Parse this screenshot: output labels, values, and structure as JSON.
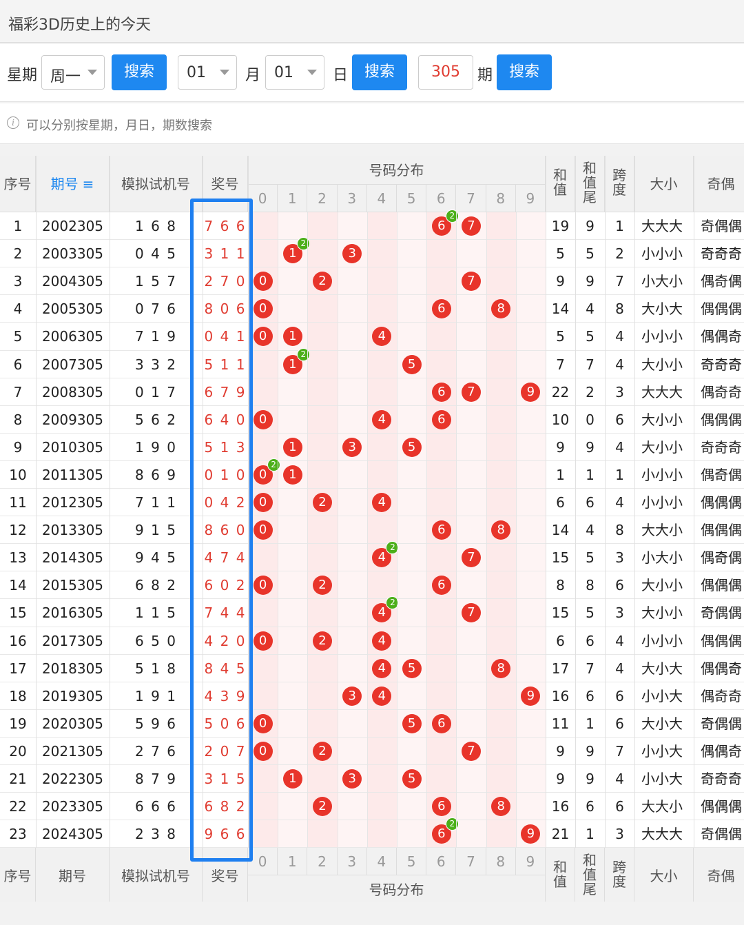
{
  "title": "福彩3D历史上的今天",
  "search": {
    "weekday_label": "星期",
    "weekday_value": "周一",
    "search_label": "搜索",
    "month_value": "01",
    "month_label": "月",
    "day_value": "01",
    "day_label": "日",
    "issue_value": "305",
    "issue_label": "期"
  },
  "hint": "可以分别按星期，月日，期数搜索",
  "table": {
    "headers": {
      "seq": "序号",
      "issue": "期号",
      "sim": "模拟试机号",
      "prize": "奖号",
      "dist": "号码分布",
      "sum": "和值",
      "sum_tail": "和值尾",
      "span": "跨度",
      "size": "大小",
      "parity": "奇偶"
    },
    "digits": [
      "0",
      "1",
      "2",
      "3",
      "4",
      "5",
      "6",
      "7",
      "8",
      "9"
    ],
    "rows": [
      {
        "seq": "1",
        "issue": "2002305",
        "sim": "1 6 8",
        "prize": "7 6 6",
        "sum": "19",
        "tail": "9",
        "span": "1",
        "size": "大大大",
        "parity": "奇偶偶"
      },
      {
        "seq": "2",
        "issue": "2003305",
        "sim": "0 4 5",
        "prize": "3 1 1",
        "sum": "5",
        "tail": "5",
        "span": "2",
        "size": "小小小",
        "parity": "奇奇奇"
      },
      {
        "seq": "3",
        "issue": "2004305",
        "sim": "1 5 7",
        "prize": "2 7 0",
        "sum": "9",
        "tail": "9",
        "span": "7",
        "size": "小大小",
        "parity": "偶奇偶"
      },
      {
        "seq": "4",
        "issue": "2005305",
        "sim": "0 7 6",
        "prize": "8 0 6",
        "sum": "14",
        "tail": "4",
        "span": "8",
        "size": "大小大",
        "parity": "偶偶偶"
      },
      {
        "seq": "5",
        "issue": "2006305",
        "sim": "7 1 9",
        "prize": "0 4 1",
        "sum": "5",
        "tail": "5",
        "span": "4",
        "size": "小小小",
        "parity": "偶偶奇"
      },
      {
        "seq": "6",
        "issue": "2007305",
        "sim": "3 3 2",
        "prize": "5 1 1",
        "sum": "7",
        "tail": "7",
        "span": "4",
        "size": "大小小",
        "parity": "奇奇奇"
      },
      {
        "seq": "7",
        "issue": "2008305",
        "sim": "0 1 7",
        "prize": "6 7 9",
        "sum": "22",
        "tail": "2",
        "span": "3",
        "size": "大大大",
        "parity": "偶奇奇"
      },
      {
        "seq": "8",
        "issue": "2009305",
        "sim": "5 6 2",
        "prize": "6 4 0",
        "sum": "10",
        "tail": "0",
        "span": "6",
        "size": "大小小",
        "parity": "偶偶偶"
      },
      {
        "seq": "9",
        "issue": "2010305",
        "sim": "1 9 0",
        "prize": "5 1 3",
        "sum": "9",
        "tail": "9",
        "span": "4",
        "size": "大小小",
        "parity": "奇奇奇"
      },
      {
        "seq": "10",
        "issue": "2011305",
        "sim": "8 6 9",
        "prize": "0 1 0",
        "sum": "1",
        "tail": "1",
        "span": "1",
        "size": "小小小",
        "parity": "偶奇偶"
      },
      {
        "seq": "11",
        "issue": "2012305",
        "sim": "7 1 1",
        "prize": "0 4 2",
        "sum": "6",
        "tail": "6",
        "span": "4",
        "size": "小小小",
        "parity": "偶偶偶"
      },
      {
        "seq": "12",
        "issue": "2013305",
        "sim": "9 1 5",
        "prize": "8 6 0",
        "sum": "14",
        "tail": "4",
        "span": "8",
        "size": "大大小",
        "parity": "偶偶偶"
      },
      {
        "seq": "13",
        "issue": "2014305",
        "sim": "9 4 5",
        "prize": "4 7 4",
        "sum": "15",
        "tail": "5",
        "span": "3",
        "size": "小大小",
        "parity": "偶奇偶"
      },
      {
        "seq": "14",
        "issue": "2015305",
        "sim": "6 8 2",
        "prize": "6 0 2",
        "sum": "8",
        "tail": "8",
        "span": "6",
        "size": "大小小",
        "parity": "偶偶偶"
      },
      {
        "seq": "15",
        "issue": "2016305",
        "sim": "1 1 5",
        "prize": "7 4 4",
        "sum": "15",
        "tail": "5",
        "span": "3",
        "size": "大小小",
        "parity": "奇偶偶"
      },
      {
        "seq": "16",
        "issue": "2017305",
        "sim": "6 5 0",
        "prize": "4 2 0",
        "sum": "6",
        "tail": "6",
        "span": "4",
        "size": "小小小",
        "parity": "偶偶偶"
      },
      {
        "seq": "17",
        "issue": "2018305",
        "sim": "5 1 8",
        "prize": "8 4 5",
        "sum": "17",
        "tail": "7",
        "span": "4",
        "size": "大小大",
        "parity": "偶偶奇"
      },
      {
        "seq": "18",
        "issue": "2019305",
        "sim": "1 9 1",
        "prize": "4 3 9",
        "sum": "16",
        "tail": "6",
        "span": "6",
        "size": "小小大",
        "parity": "偶奇奇"
      },
      {
        "seq": "19",
        "issue": "2020305",
        "sim": "5 9 6",
        "prize": "5 0 6",
        "sum": "11",
        "tail": "1",
        "span": "6",
        "size": "大小大",
        "parity": "奇偶偶"
      },
      {
        "seq": "20",
        "issue": "2021305",
        "sim": "2 7 6",
        "prize": "2 0 7",
        "sum": "9",
        "tail": "9",
        "span": "7",
        "size": "小小大",
        "parity": "偶偶奇"
      },
      {
        "seq": "21",
        "issue": "2022305",
        "sim": "8 7 9",
        "prize": "3 1 5",
        "sum": "9",
        "tail": "9",
        "span": "4",
        "size": "小小大",
        "parity": "奇奇奇"
      },
      {
        "seq": "22",
        "issue": "2023305",
        "sim": "6 6 6",
        "prize": "6 8 2",
        "sum": "16",
        "tail": "6",
        "span": "6",
        "size": "大大小",
        "parity": "偶偶偶"
      },
      {
        "seq": "23",
        "issue": "2024305",
        "sim": "2 3 8",
        "prize": "9 6 6",
        "sum": "21",
        "tail": "1",
        "span": "3",
        "size": "大大大",
        "parity": "奇偶偶"
      }
    ]
  },
  "colors": {
    "ball": "#e8342a",
    "dup_badge": "#4caf1a",
    "highlight": "#1e7ff0",
    "accent": "#1e88f0"
  },
  "icons": {
    "hint": "info-circle-icon",
    "sort": "sort-icon",
    "caret": "chevron-down-icon"
  }
}
